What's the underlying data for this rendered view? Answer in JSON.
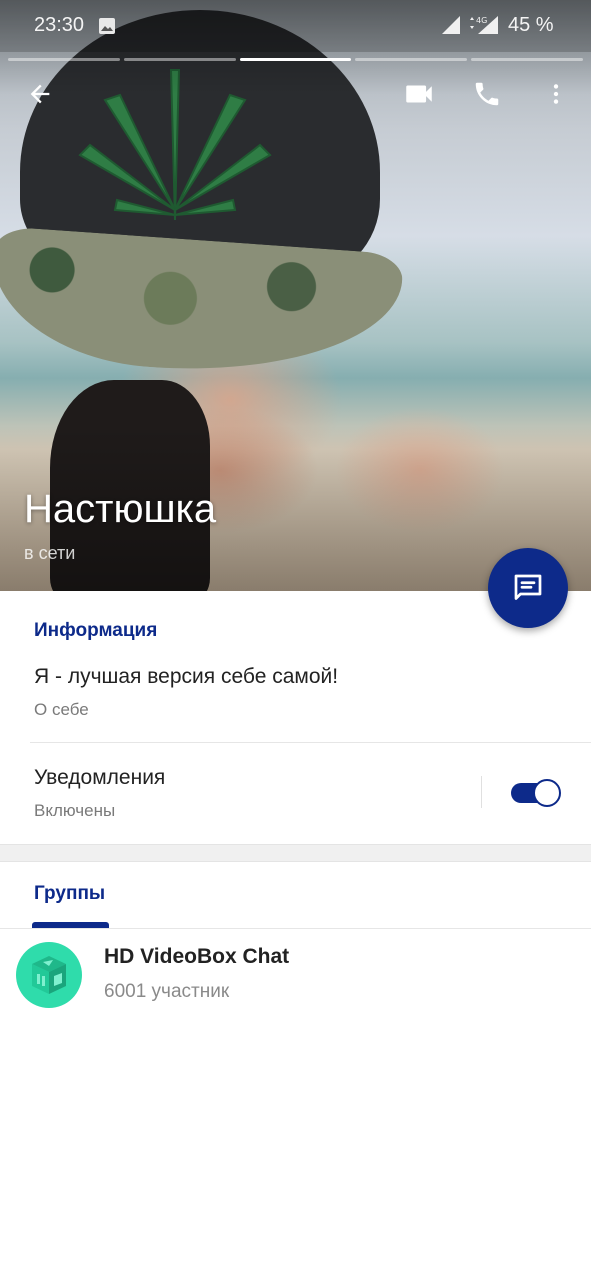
{
  "status_bar": {
    "time": "23:30",
    "battery": "45 %",
    "network": "4G"
  },
  "icons": {
    "gallery": "image-icon",
    "signal": "signal-icon",
    "back": "arrow-left-icon",
    "video": "video-camera-icon",
    "call": "phone-icon",
    "more": "more-vertical-icon",
    "message": "message-icon"
  },
  "story_progress": {
    "segments": 5,
    "active_index": 2
  },
  "profile": {
    "name": "Настюшка",
    "status": "в сети"
  },
  "info": {
    "title": "Информация",
    "bio": "Я - лучшая версия себе самой!",
    "bio_label": "О себе",
    "notifications_label": "Уведомления",
    "notifications_state": "Включены",
    "notifications_enabled": true
  },
  "tabs": {
    "groups_label": "Группы"
  },
  "groups": [
    {
      "name": "HD VideoBox Chat",
      "members": "6001 участник"
    }
  ],
  "colors": {
    "accent": "#0d2a8a",
    "group_avatar": "#2fdcab"
  }
}
